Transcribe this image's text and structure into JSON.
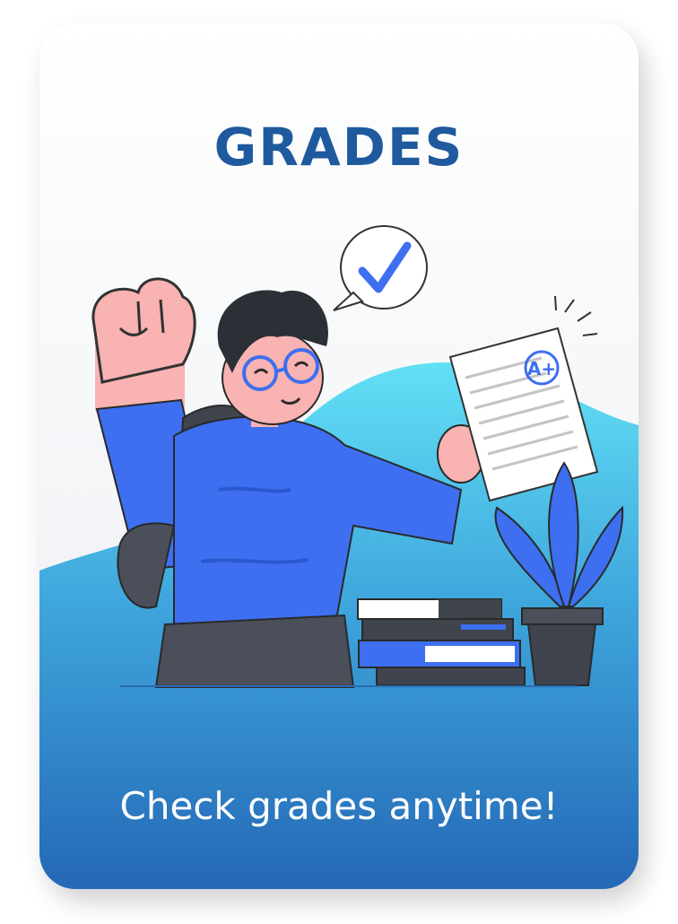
{
  "card": {
    "title": "GRADES",
    "slogan": "Check grades anytime!"
  },
  "illustration": {
    "grade_mark": "A+",
    "icons": [
      "check-icon",
      "fist-icon",
      "paper-icon",
      "plant-icon",
      "books-icon"
    ]
  },
  "colors": {
    "title": "#1f5a9e",
    "accent_blue": "#3d6ff0",
    "wave_light": "#62e0f5",
    "wave_dark": "#2670b8"
  }
}
